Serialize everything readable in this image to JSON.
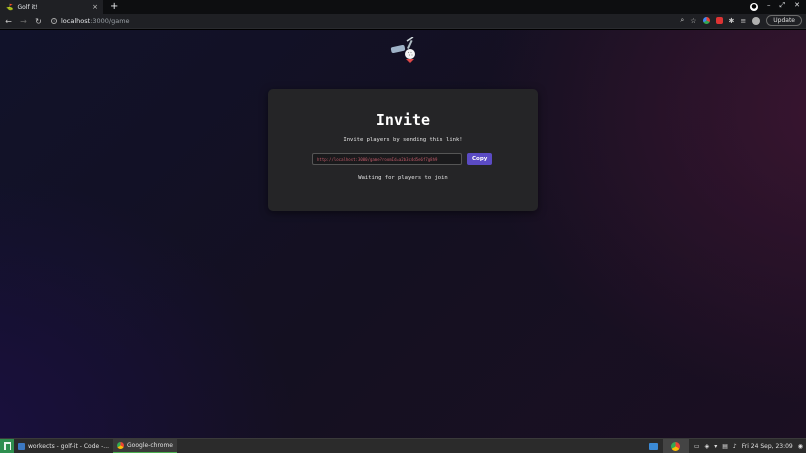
{
  "browser": {
    "tab": {
      "title": "Golf it!",
      "close": "×"
    },
    "new_tab": "+",
    "window_controls": [
      "–",
      "⤢",
      "✕"
    ],
    "address": {
      "host": "localhost",
      "path": ":3000/game"
    },
    "update_label": "Update"
  },
  "page": {
    "title": "Invite",
    "subtitle": "Invite players by sending this link!",
    "invite_link": "http://localhost:3000/game?roomId=a2b3c4d5e6f7g8h9",
    "copy_label": "Copy",
    "waiting": "Waiting for players to join"
  },
  "taskbar": {
    "tasks": [
      {
        "label": "workects - golf-it - Code -..."
      },
      {
        "label": "Google-chrome"
      }
    ],
    "clock": "Fri 24 Sep, 23:09"
  },
  "colors": {
    "accent": "#5b4bc4",
    "card": "#252527",
    "link_text": "#c45b6a"
  }
}
